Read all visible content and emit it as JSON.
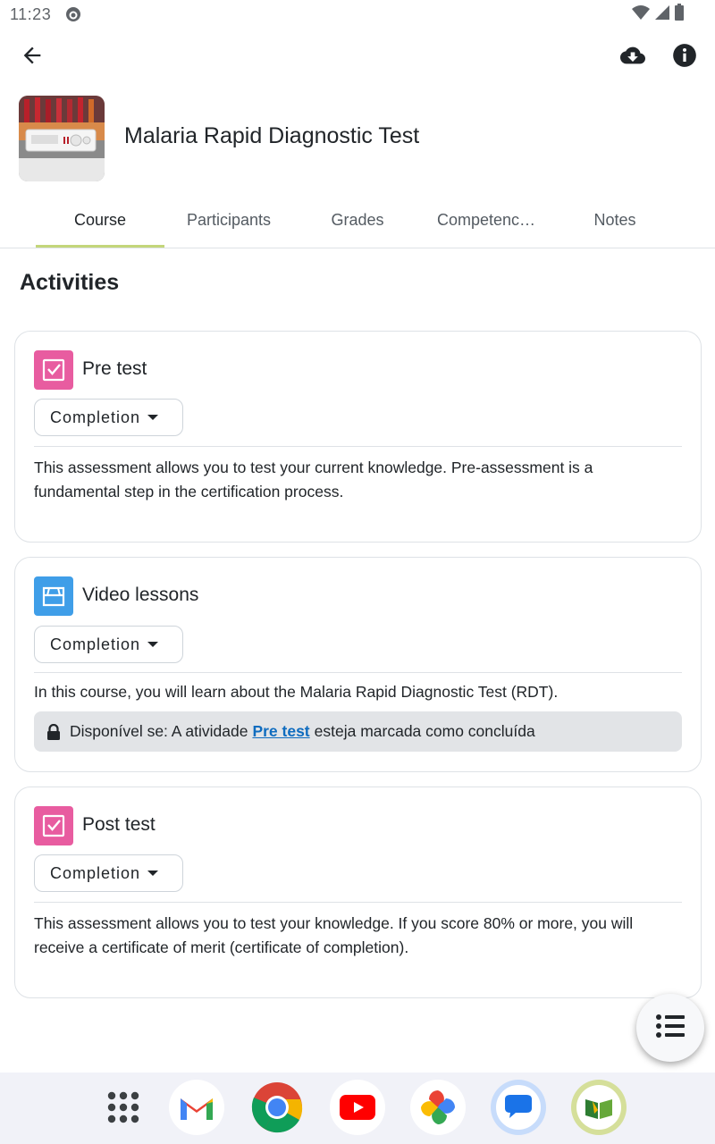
{
  "status_bar": {
    "time": "11:23"
  },
  "appbar": {
    "back_icon": "arrow-back-icon",
    "download_icon": "cloud-download-icon",
    "info_icon": "info-icon"
  },
  "course": {
    "title": "Malaria Rapid Diagnostic Test"
  },
  "tabs": [
    {
      "label": "Course",
      "active": true
    },
    {
      "label": "Participants",
      "active": false
    },
    {
      "label": "Grades",
      "active": false
    },
    {
      "label": "Competenc…",
      "active": false
    },
    {
      "label": "Notes",
      "active": false
    }
  ],
  "section": {
    "title": "Activities"
  },
  "activities": [
    {
      "name": "Pre test",
      "icon": "quiz-icon",
      "icon_color": "#e85ca0",
      "completion_label": "Completion",
      "description": "This assessment allows you to test your current knowledge. Pre-assessment is a fundamental step in the certification process."
    },
    {
      "name": "Video lessons",
      "icon": "package-icon",
      "icon_color": "#3f9ee8",
      "completion_label": "Completion",
      "description": "In this course, you will learn about the Malaria Rapid Diagnostic Test (RDT).",
      "restriction": {
        "prefix": "Disponível se: A atividade",
        "link": "Pre test",
        "suffix": "esteja marcada como concluída"
      }
    },
    {
      "name": "Post test",
      "icon": "quiz-icon",
      "icon_color": "#e85ca0",
      "completion_label": "Completion",
      "description": "This assessment allows you to test your knowledge. If you score 80% or more, you will receive a certificate of merit (certificate of completion)."
    }
  ],
  "fab": {
    "icon": "course-index-icon"
  },
  "dock": [
    "apps-grid-icon",
    "gmail-icon",
    "chrome-icon",
    "youtube-icon",
    "photos-icon",
    "messages-icon",
    "moodle-app-icon"
  ]
}
